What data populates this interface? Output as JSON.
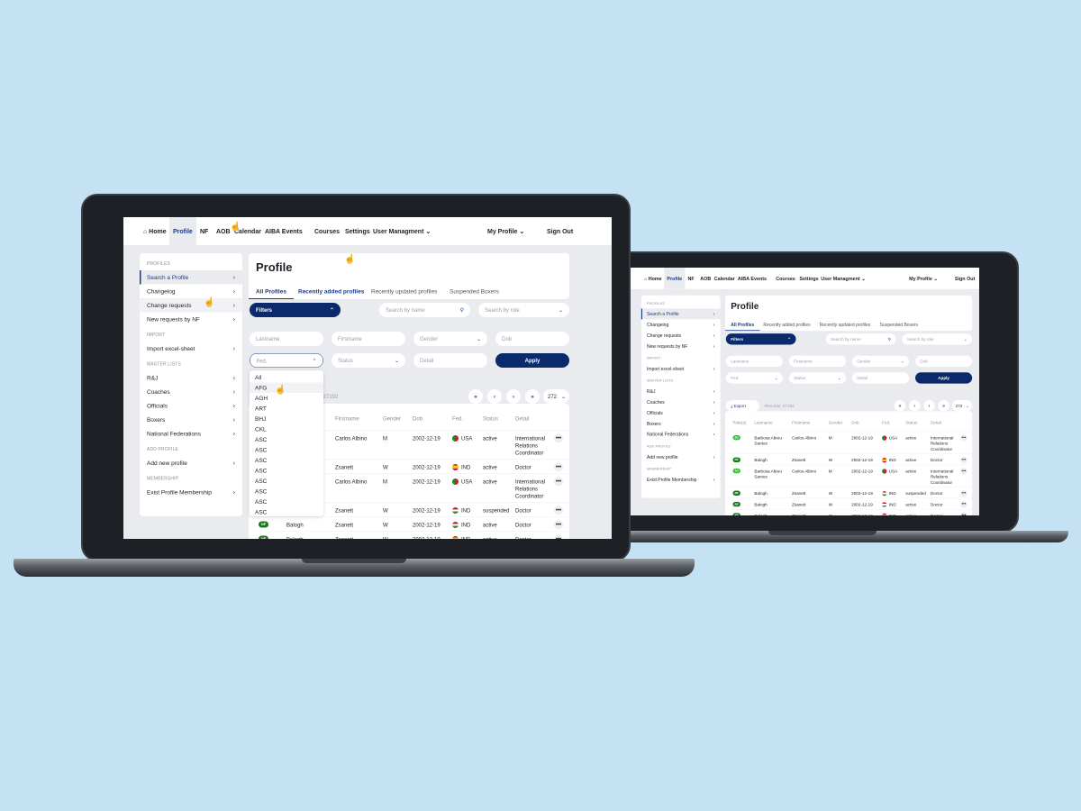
{
  "colors": {
    "page_background": "#c4e2f3",
    "brand_navy": "#0b2a6b",
    "accent": "#1a3a8a",
    "badge_rj": "#3cc13c",
    "badge_nf": "#1b7a1b"
  },
  "nav": {
    "home_icon": "home-icon",
    "items": [
      "Home",
      "Profile",
      "NF",
      "AOB",
      "Calendar",
      "AIBA Events",
      "Courses",
      "Settings",
      "User Managment"
    ],
    "my_profile": "My Profile",
    "sign_out": "Sign Out"
  },
  "sidebar": {
    "sections": [
      {
        "title": "PROFILES",
        "items": [
          "Search a Profile",
          "Changelog",
          "Change requests",
          "New requests by NF"
        ]
      },
      {
        "title": "IMPORT",
        "items": [
          "Import excel-sheet"
        ]
      },
      {
        "title": "MASTER LISTS",
        "items": [
          "R&J",
          "Coaches",
          "Officials",
          "Boxers",
          "National Federations"
        ]
      },
      {
        "title": "ADD PROFILE",
        "items": [
          "Add new profile"
        ]
      },
      {
        "title": "MEMBERSHIP",
        "items": [
          "Exist Profile Membership"
        ]
      }
    ]
  },
  "main": {
    "title": "Profile",
    "tabs": [
      "All Profiles",
      "Recently added profiles",
      "Recently updated profiles",
      "Suspended Boxers"
    ],
    "filters_label": "Filters",
    "search_name_placeholder": "Search by name",
    "search_role_placeholder": "Search by role",
    "fields": {
      "lastname": "Lastname",
      "firstname": "Firstname",
      "gender": "Gender",
      "dob": "Dob",
      "fed": "Fed.",
      "status": "Status",
      "detail": "Detail"
    },
    "apply_label": "Apply",
    "export_label": "Export",
    "records": "Records: 27192",
    "pager": {
      "first": "«",
      "prev": "‹",
      "next": "›",
      "last": "»",
      "page_size": "272"
    },
    "fed_options": [
      "All",
      "AFG",
      "AGH",
      "ART",
      "BHJ",
      "CKL",
      "ASC",
      "ASC",
      "ASC",
      "ASC",
      "ASC",
      "ASC",
      "ASC",
      "ASC"
    ],
    "table": {
      "headers": [
        "Role(s)",
        "Lastname",
        "Firstname",
        "Gender",
        "Dob",
        "Fed.",
        "Status",
        "Detail"
      ],
      "rows": [
        {
          "role": "RJ",
          "lastname": "Barbosa Abreu Santos",
          "firstname": "Carlos Albino",
          "gender": "M",
          "dob": "2002-12-19",
          "flag": "portugal",
          "fed": "USA",
          "status": "active",
          "detail": "International Relations Coordinator"
        },
        {
          "role": "NF",
          "lastname": "Balogh",
          "firstname": "Zsanett",
          "gender": "W",
          "dob": "2002-12-19",
          "flag": "spain",
          "fed": "IND",
          "status": "active",
          "detail": "Doctor"
        },
        {
          "role": "RJ",
          "lastname": "Barbosa Abreu Santos",
          "firstname": "Carlos Albino",
          "gender": "M",
          "dob": "2002-12-19",
          "flag": "portugal",
          "fed": "USA",
          "status": "active",
          "detail": "International Relations Coordinator"
        },
        {
          "role": "NF",
          "lastname": "Balogh",
          "firstname": "Zsanett",
          "gender": "W",
          "dob": "2002-12-19",
          "flag": "hungary",
          "fed": "IND",
          "status": "suspended",
          "detail": "Doctor"
        },
        {
          "role": "NF",
          "lastname": "Balogh",
          "firstname": "Zsanett",
          "gender": "W",
          "dob": "2002-12-19",
          "flag": "hungary",
          "fed": "IND",
          "status": "active",
          "detail": "Doctor"
        },
        {
          "role": "NF",
          "lastname": "Balogh",
          "firstname": "Zsanett",
          "gender": "W",
          "dob": "2002-12-19",
          "flag": "spain",
          "fed": "IND",
          "status": "active",
          "detail": "Doctor"
        }
      ]
    }
  }
}
